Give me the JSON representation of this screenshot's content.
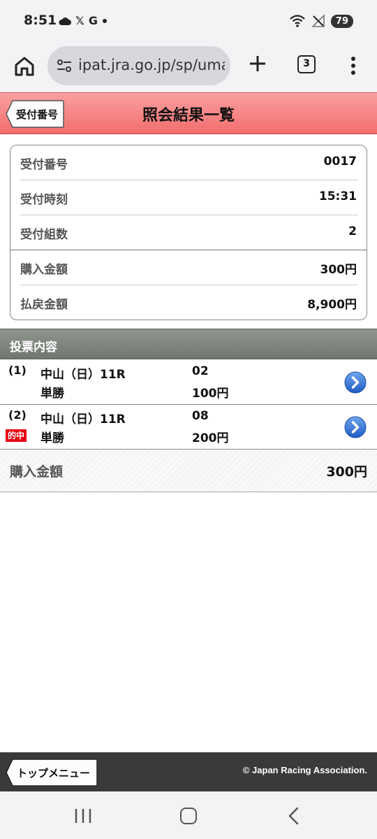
{
  "status_bar": {
    "time": "8:51",
    "left_icons": [
      "cloud-icon",
      "x-icon",
      "g-icon",
      "dot-icon"
    ],
    "x_glyph": "𝕏",
    "g_glyph": "G",
    "battery": "79"
  },
  "browser": {
    "url": "ipat.jra.go.jp/sp/uma",
    "tab_count": "3"
  },
  "header": {
    "back_label": "受付番号",
    "title": "照会結果一覧"
  },
  "summary": {
    "rows": [
      {
        "label": "受付番号",
        "value": "0017"
      },
      {
        "label": "受付時刻",
        "value": "15:31"
      },
      {
        "label": "受付組数",
        "value": "2"
      },
      {
        "label": "購入金額",
        "value": "300円"
      },
      {
        "label": "払戻金額",
        "value": "8,900円"
      }
    ]
  },
  "section": {
    "title": "投票内容"
  },
  "bets": [
    {
      "index": "(1)",
      "race": "中山（日）11R",
      "type": "単勝",
      "horse": "02",
      "amount": "100円",
      "hit": ""
    },
    {
      "index": "(2)",
      "race": "中山（日）11R",
      "type": "単勝",
      "horse": "08",
      "amount": "200円",
      "hit": "的中"
    }
  ],
  "total": {
    "label": "購入金額",
    "value": "300円"
  },
  "footer": {
    "top_menu_label": "トップメニュー",
    "copyright": "© Japan Racing Association."
  },
  "colors": {
    "header_red": "#f26d6d",
    "section_gray": "#7a827a",
    "hit_red": "#e60012",
    "arrow_blue": "#2f6fd0"
  }
}
